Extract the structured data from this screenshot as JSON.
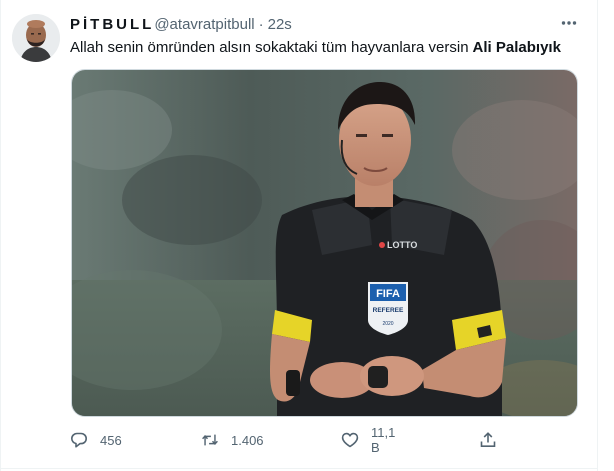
{
  "tweet": {
    "display_name": "PİTBULL",
    "handle": "@atavratpitbull",
    "separator": "·",
    "time": "22s",
    "text": "Allah senin ömründen alsın sokaktaki tüm hayvanlara versin",
    "mention": "Ali Palabıyık",
    "media": {
      "logo_text": "LOTTO",
      "badge_title": "FIFA",
      "badge_sub": "REFEREE",
      "badge_year": "2020"
    }
  },
  "actions": {
    "replies": "456",
    "retweets": "1.406",
    "likes": "11,1 B"
  },
  "icons": {
    "more": "more-dots-icon",
    "reply": "reply-icon",
    "retweet": "retweet-icon",
    "like": "heart-icon",
    "share": "share-icon"
  },
  "colors": {
    "text": "#0f1419",
    "secondary": "#536471",
    "border": "#cfd9de"
  }
}
